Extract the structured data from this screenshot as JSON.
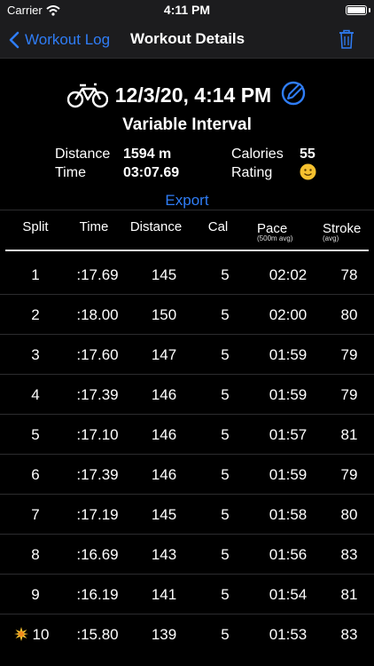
{
  "status_bar": {
    "carrier": "Carrier",
    "time": "4:11 PM",
    "icons": [
      "wifi-icon",
      "battery-icon"
    ]
  },
  "nav": {
    "back_label": "Workout Log",
    "title": "Workout Details",
    "icons": [
      "chevron-left-icon",
      "trash-icon"
    ]
  },
  "workout": {
    "date": "12/3/20, 4:14 PM",
    "name": "Variable Interval",
    "icons": [
      "bike-icon",
      "edit-icon"
    ],
    "stats": {
      "distance_label": "Distance",
      "distance_value": "1594 m",
      "time_label": "Time",
      "time_value": "03:07.69",
      "calories_label": "Calories",
      "calories_value": "55",
      "rating_label": "Rating",
      "rating_icon": "smiley-emoji-icon"
    },
    "export_label": "Export"
  },
  "table": {
    "headers": {
      "split": "Split",
      "time": "Time",
      "distance": "Distance",
      "cal": "Cal",
      "pace": "Pace",
      "pace_sub": "(500m avg)",
      "stroke": "Stroke",
      "stroke_sub": "(avg)"
    },
    "rows": [
      {
        "split": "1",
        "time": ":17.69",
        "distance": "145",
        "cal": "5",
        "pace": "02:02",
        "stroke": "78"
      },
      {
        "split": "2",
        "time": ":18.00",
        "distance": "150",
        "cal": "5",
        "pace": "02:00",
        "stroke": "80"
      },
      {
        "split": "3",
        "time": ":17.60",
        "distance": "147",
        "cal": "5",
        "pace": "01:59",
        "stroke": "79"
      },
      {
        "split": "4",
        "time": ":17.39",
        "distance": "146",
        "cal": "5",
        "pace": "01:59",
        "stroke": "79"
      },
      {
        "split": "5",
        "time": ":17.10",
        "distance": "146",
        "cal": "5",
        "pace": "01:57",
        "stroke": "81"
      },
      {
        "split": "6",
        "time": ":17.39",
        "distance": "146",
        "cal": "5",
        "pace": "01:59",
        "stroke": "79"
      },
      {
        "split": "7",
        "time": ":17.19",
        "distance": "145",
        "cal": "5",
        "pace": "01:58",
        "stroke": "80"
      },
      {
        "split": "8",
        "time": ":16.69",
        "distance": "143",
        "cal": "5",
        "pace": "01:56",
        "stroke": "83"
      },
      {
        "split": "9",
        "time": ":16.19",
        "distance": "141",
        "cal": "5",
        "pace": "01:54",
        "stroke": "81"
      },
      {
        "split": "10",
        "time": ":15.80",
        "distance": "139",
        "cal": "5",
        "pace": "01:53",
        "stroke": "83",
        "best": true
      }
    ]
  },
  "colors": {
    "accent": "#2f7df6",
    "bar_background": "#1c1c1e",
    "background": "#000000"
  }
}
